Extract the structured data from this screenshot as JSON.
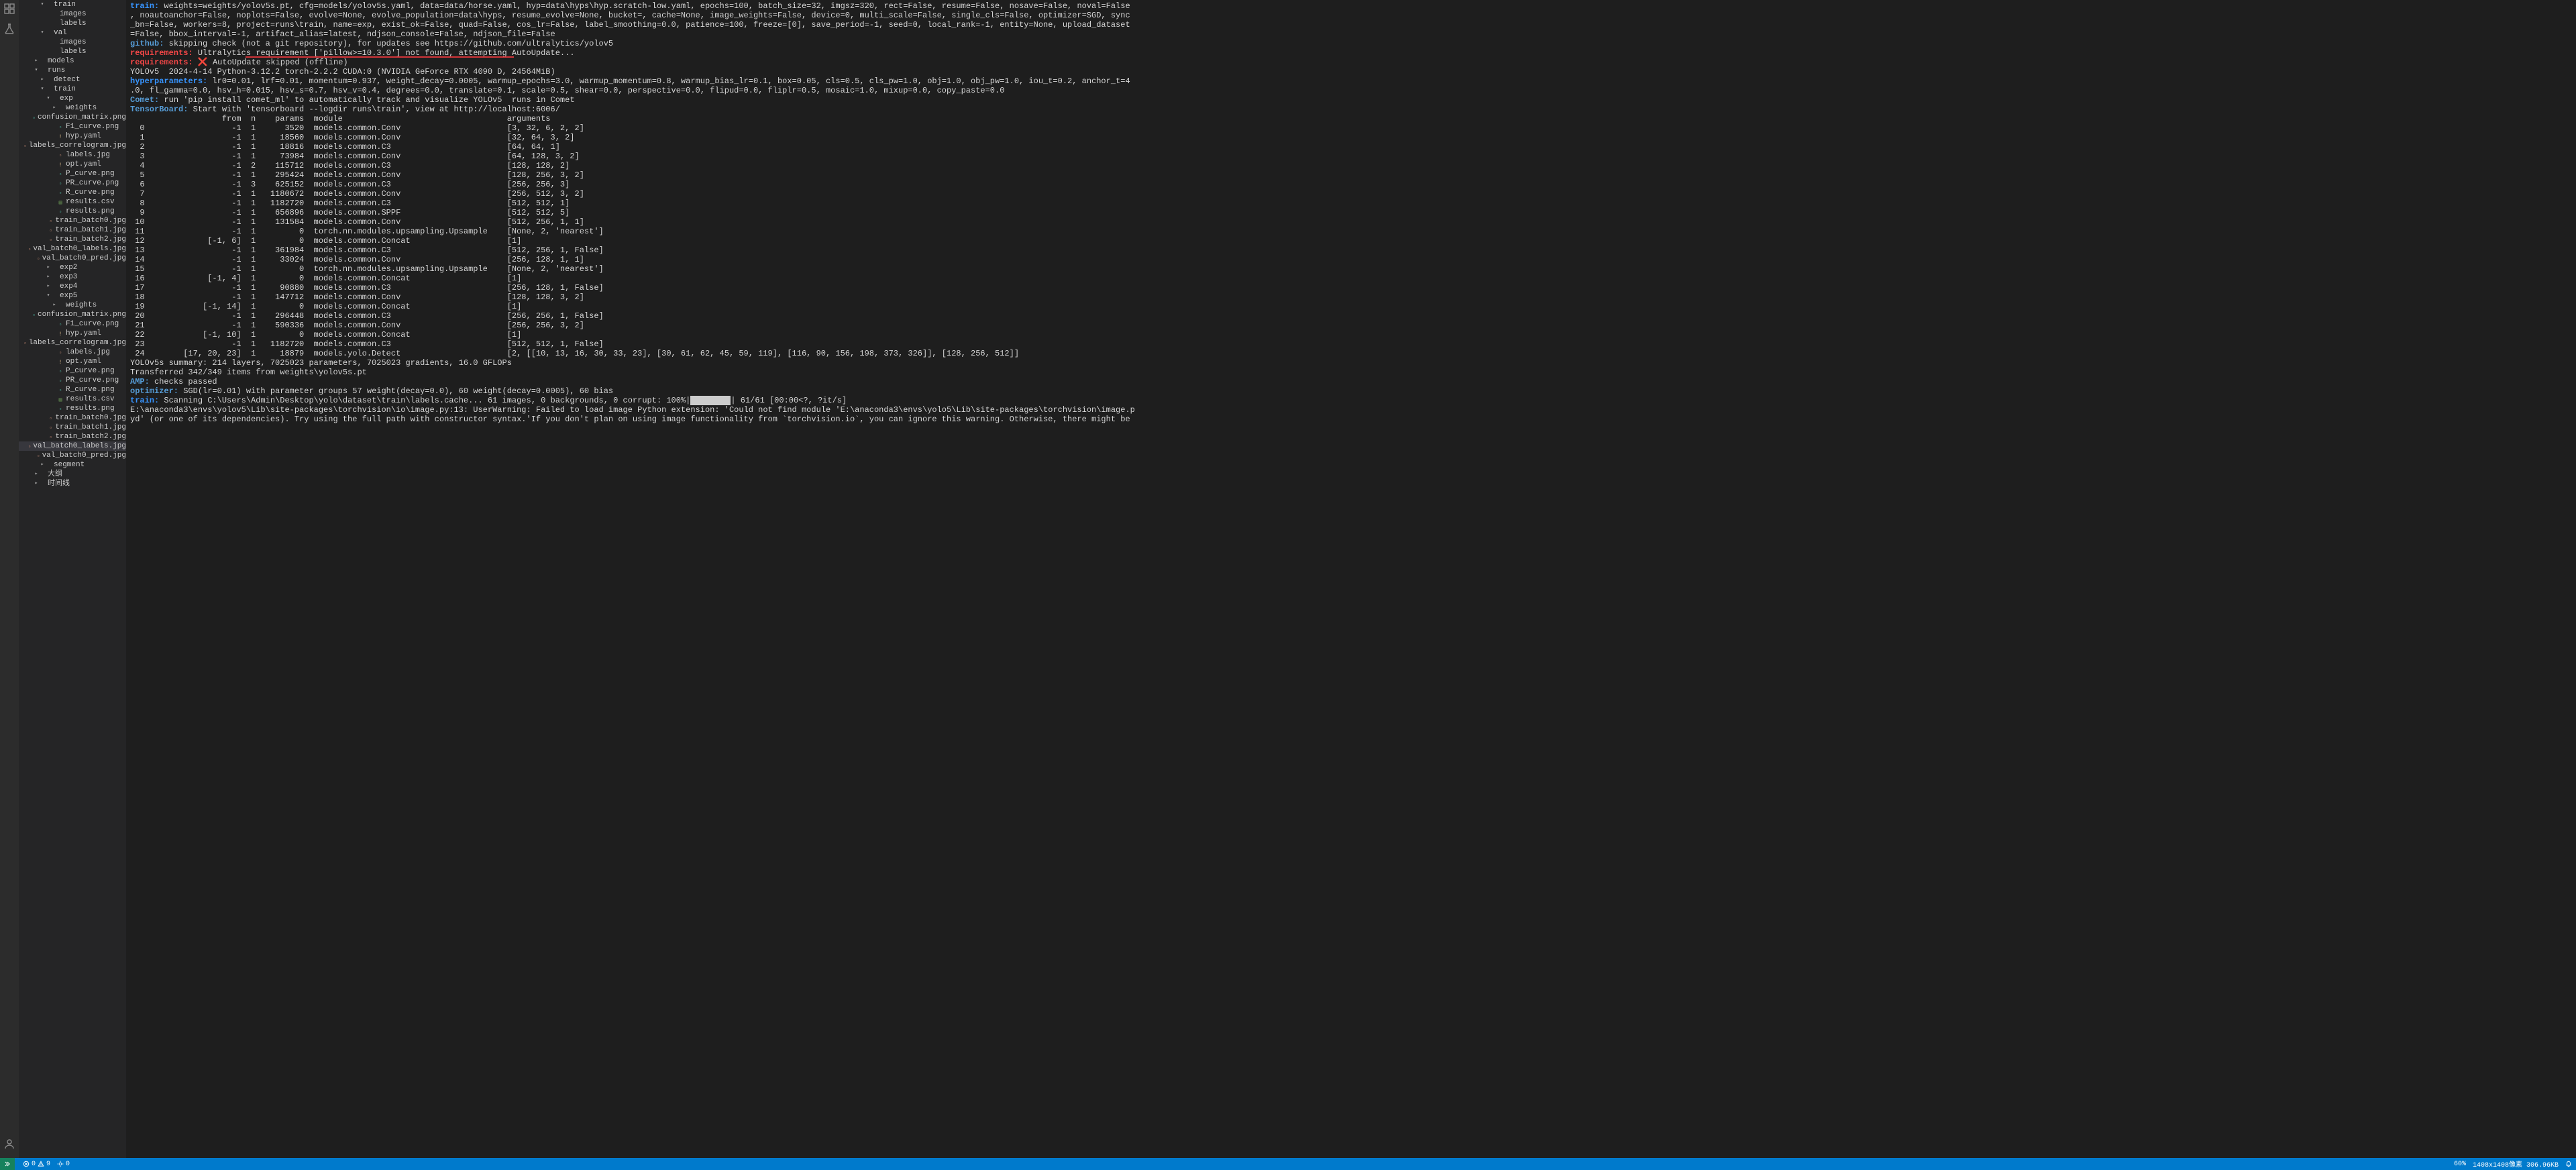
{
  "activity_icons": [
    "extensions-icon",
    "flask-icon"
  ],
  "activity_bottom": [
    "account-icon",
    "gear-icon"
  ],
  "tree": [
    {
      "depth": 3,
      "chev": "▾",
      "label": "train",
      "ico": ""
    },
    {
      "depth": 4,
      "chev": "",
      "label": "images",
      "ico": ""
    },
    {
      "depth": 4,
      "chev": "",
      "label": "labels",
      "ico": ""
    },
    {
      "depth": 3,
      "chev": "▾",
      "label": "val",
      "ico": ""
    },
    {
      "depth": 4,
      "chev": "",
      "label": "images",
      "ico": ""
    },
    {
      "depth": 4,
      "chev": "",
      "label": "labels",
      "ico": ""
    },
    {
      "depth": 2,
      "chev": "▸",
      "label": "models",
      "ico": ""
    },
    {
      "depth": 2,
      "chev": "▾",
      "label": "runs",
      "ico": ""
    },
    {
      "depth": 3,
      "chev": "▸",
      "label": "detect",
      "ico": ""
    },
    {
      "depth": 3,
      "chev": "▾",
      "label": "train",
      "ico": ""
    },
    {
      "depth": 4,
      "chev": "▾",
      "label": "exp",
      "ico": ""
    },
    {
      "depth": 5,
      "chev": "▸",
      "label": "weights",
      "ico": ""
    },
    {
      "depth": 5,
      "chev": "",
      "label": "confusion_matrix.png",
      "ico": "png"
    },
    {
      "depth": 5,
      "chev": "",
      "label": "F1_curve.png",
      "ico": "png"
    },
    {
      "depth": 5,
      "chev": "",
      "label": "hyp.yaml",
      "ico": "yaml"
    },
    {
      "depth": 5,
      "chev": "",
      "label": "labels_correlogram.jpg",
      "ico": "jpg"
    },
    {
      "depth": 5,
      "chev": "",
      "label": "labels.jpg",
      "ico": "jpg"
    },
    {
      "depth": 5,
      "chev": "",
      "label": "opt.yaml",
      "ico": "yaml"
    },
    {
      "depth": 5,
      "chev": "",
      "label": "P_curve.png",
      "ico": "png"
    },
    {
      "depth": 5,
      "chev": "",
      "label": "PR_curve.png",
      "ico": "png"
    },
    {
      "depth": 5,
      "chev": "",
      "label": "R_curve.png",
      "ico": "png"
    },
    {
      "depth": 5,
      "chev": "",
      "label": "results.csv",
      "ico": "csv"
    },
    {
      "depth": 5,
      "chev": "",
      "label": "results.png",
      "ico": "png"
    },
    {
      "depth": 5,
      "chev": "",
      "label": "train_batch0.jpg",
      "ico": "jpg"
    },
    {
      "depth": 5,
      "chev": "",
      "label": "train_batch1.jpg",
      "ico": "jpg"
    },
    {
      "depth": 5,
      "chev": "",
      "label": "train_batch2.jpg",
      "ico": "jpg"
    },
    {
      "depth": 5,
      "chev": "",
      "label": "val_batch0_labels.jpg",
      "ico": "jpg"
    },
    {
      "depth": 5,
      "chev": "",
      "label": "val_batch0_pred.jpg",
      "ico": "jpg"
    },
    {
      "depth": 4,
      "chev": "▸",
      "label": "exp2",
      "ico": ""
    },
    {
      "depth": 4,
      "chev": "▸",
      "label": "exp3",
      "ico": ""
    },
    {
      "depth": 4,
      "chev": "▸",
      "label": "exp4",
      "ico": ""
    },
    {
      "depth": 4,
      "chev": "▾",
      "label": "exp5",
      "ico": ""
    },
    {
      "depth": 5,
      "chev": "▸",
      "label": "weights",
      "ico": ""
    },
    {
      "depth": 5,
      "chev": "",
      "label": "confusion_matrix.png",
      "ico": "png"
    },
    {
      "depth": 5,
      "chev": "",
      "label": "F1_curve.png",
      "ico": "png"
    },
    {
      "depth": 5,
      "chev": "",
      "label": "hyp.yaml",
      "ico": "yaml"
    },
    {
      "depth": 5,
      "chev": "",
      "label": "labels_correlogram.jpg",
      "ico": "jpg"
    },
    {
      "depth": 5,
      "chev": "",
      "label": "labels.jpg",
      "ico": "jpg"
    },
    {
      "depth": 5,
      "chev": "",
      "label": "opt.yaml",
      "ico": "yaml"
    },
    {
      "depth": 5,
      "chev": "",
      "label": "P_curve.png",
      "ico": "png"
    },
    {
      "depth": 5,
      "chev": "",
      "label": "PR_curve.png",
      "ico": "png"
    },
    {
      "depth": 5,
      "chev": "",
      "label": "R_curve.png",
      "ico": "png"
    },
    {
      "depth": 5,
      "chev": "",
      "label": "results.csv",
      "ico": "csv"
    },
    {
      "depth": 5,
      "chev": "",
      "label": "results.png",
      "ico": "png"
    },
    {
      "depth": 5,
      "chev": "",
      "label": "train_batch0.jpg",
      "ico": "jpg"
    },
    {
      "depth": 5,
      "chev": "",
      "label": "train_batch1.jpg",
      "ico": "jpg"
    },
    {
      "depth": 5,
      "chev": "",
      "label": "train_batch2.jpg",
      "ico": "jpg"
    },
    {
      "depth": 5,
      "chev": "",
      "label": "val_batch0_labels.jpg",
      "ico": "jpg",
      "sel": true
    },
    {
      "depth": 5,
      "chev": "",
      "label": "val_batch0_pred.jpg",
      "ico": "jpg"
    },
    {
      "depth": 3,
      "chev": "▸",
      "label": "segment",
      "ico": ""
    },
    {
      "depth": 2,
      "chev": "▸",
      "label": "大纲",
      "ico": ""
    },
    {
      "depth": 2,
      "chev": "▸",
      "label": "时间线",
      "ico": ""
    }
  ],
  "terminal": {
    "train_label": "train:",
    "train_args": " weights=weights/yolov5s.pt, cfg=models/yolov5s.yaml, data=data/horse.yaml, hyp=data\\hyps\\hyp.scratch-low.yaml, epochs=100, batch_size=32, imgsz=320, rect=False, resume=False, nosave=False, noval=False\n, noautoanchor=False, noplots=False, evolve=None, evolve_population=data\\hyps, resume_evolve=None, bucket=, cache=None, image_weights=False, device=0, multi_scale=False, single_cls=False, optimizer=SGD, sync\n_bn=False, workers=8, project=runs\\train, name=exp, exist_ok=False, quad=False, cos_lr=False, label_smoothing=0.0, patience=100, freeze=[0], save_period=-1, seed=0, local_rank=-1, entity=None, upload_dataset\n=False, bbox_interval=-1, artifact_alias=latest, ndjson_console=False, ndjson_file=False",
    "github_label": "github:",
    "github_text": " skipping check (not a git repository), for updates see https://github.com/ultralytics/yolov5",
    "req1_label": "requirements:",
    "req1_text": " Ultralytics requirement ['pillow>=10.3.0'] not found, attempting AutoUpdate...",
    "req2_label": "requirements:",
    "req2_text": " AutoUpdate skipped (offline)",
    "yolo_line": "YOLOv5  2024-4-14 Python-3.12.2 torch-2.2.2 CUDA:0 (NVIDIA GeForce RTX 4090 D, 24564MiB)",
    "hyper_label": "hyperparameters:",
    "hyper_text": " lr0=0.01, lrf=0.01, momentum=0.937, weight_decay=0.0005, warmup_epochs=3.0, warmup_momentum=0.8, warmup_bias_lr=0.1, box=0.05, cls=0.5, cls_pw=1.0, obj=1.0, obj_pw=1.0, iou_t=0.2, anchor_t=4\n.0, fl_gamma=0.0, hsv_h=0.015, hsv_s=0.7, hsv_v=0.4, degrees=0.0, translate=0.1, scale=0.5, shear=0.0, perspective=0.0, flipud=0.0, fliplr=0.5, mosaic=1.0, mixup=0.0, copy_paste=0.0",
    "comet_label": "Comet:",
    "comet_text": " run 'pip install comet_ml' to automatically track and visualize YOLOv5  runs in Comet",
    "tb_label": "TensorBoard:",
    "tb_text": " Start with 'tensorboard --logdir runs\\train', view at http://localhost:6006/",
    "table_header": "                   from  n    params  module                                  arguments",
    "table_rows": [
      "  0                  -1  1      3520  models.common.Conv                      [3, 32, 6, 2, 2]",
      "  1                  -1  1     18560  models.common.Conv                      [32, 64, 3, 2]",
      "  2                  -1  1     18816  models.common.C3                        [64, 64, 1]",
      "  3                  -1  1     73984  models.common.Conv                      [64, 128, 3, 2]",
      "  4                  -1  2    115712  models.common.C3                        [128, 128, 2]",
      "  5                  -1  1    295424  models.common.Conv                      [128, 256, 3, 2]",
      "  6                  -1  3    625152  models.common.C3                        [256, 256, 3]",
      "  7                  -1  1   1180672  models.common.Conv                      [256, 512, 3, 2]",
      "  8                  -1  1   1182720  models.common.C3                        [512, 512, 1]",
      "  9                  -1  1    656896  models.common.SPPF                      [512, 512, 5]",
      " 10                  -1  1    131584  models.common.Conv                      [512, 256, 1, 1]",
      " 11                  -1  1         0  torch.nn.modules.upsampling.Upsample    [None, 2, 'nearest']",
      " 12             [-1, 6]  1         0  models.common.Concat                    [1]",
      " 13                  -1  1    361984  models.common.C3                        [512, 256, 1, False]",
      " 14                  -1  1     33024  models.common.Conv                      [256, 128, 1, 1]",
      " 15                  -1  1         0  torch.nn.modules.upsampling.Upsample    [None, 2, 'nearest']",
      " 16             [-1, 4]  1         0  models.common.Concat                    [1]",
      " 17                  -1  1     90880  models.common.C3                        [256, 128, 1, False]",
      " 18                  -1  1    147712  models.common.Conv                      [128, 128, 3, 2]",
      " 19            [-1, 14]  1         0  models.common.Concat                    [1]",
      " 20                  -1  1    296448  models.common.C3                        [256, 256, 1, False]",
      " 21                  -1  1    590336  models.common.Conv                      [256, 256, 3, 2]",
      " 22            [-1, 10]  1         0  models.common.Concat                    [1]",
      " 23                  -1  1   1182720  models.common.C3                        [512, 512, 1, False]",
      " 24        [17, 20, 23]  1     18879  models.yolo.Detect                      [2, [[10, 13, 16, 30, 33, 23], [30, 61, 62, 45, 59, 119], [116, 90, 156, 198, 373, 326]], [128, 256, 512]]"
    ],
    "summary": "YOLOv5s summary: 214 layers, 7025023 parameters, 7025023 gradients, 16.0 GFLOPs",
    "transferred": "Transferred 342/349 items from weights\\yolov5s.pt",
    "amp_label": "AMP:",
    "amp_text": " checks passed",
    "opt_label": "optimizer:",
    "opt_text": " SGD(lr=0.01) with parameter groups 57 weight(decay=0.0), 60 weight(decay=0.0005), 60 bias",
    "scan_label": "train:",
    "scan_text_a": " Scanning C:\\Users\\Admin\\Desktop\\yolo\\dataset\\train\\labels.cache... 61 images, 0 backgrounds, 0 corrupt: 100%|",
    "scan_text_b": "| 61/61 [00:00<?, ?it/s]",
    "warn": "E:\\anaconda3\\envs\\yolov5\\Lib\\site-packages\\torchvision\\io\\image.py:13: UserWarning: Failed to load image Python extension: 'Could not find module 'E:\\anaconda3\\envs\\yolo5\\Lib\\site-packages\\torchvision\\image.p\nyd' (or one of its dependencies). Try using the full path with constructor syntax.'If you don't plan on using image functionality from `torchvision.io`, you can ignore this warning. Otherwise, there might be"
  },
  "statusbar": {
    "errors": "0",
    "warnings": "9",
    "ports": "0",
    "zoom": "60%",
    "dims": "1408x1408像素 306.96KB"
  },
  "icons": {
    "cross": "❌"
  }
}
